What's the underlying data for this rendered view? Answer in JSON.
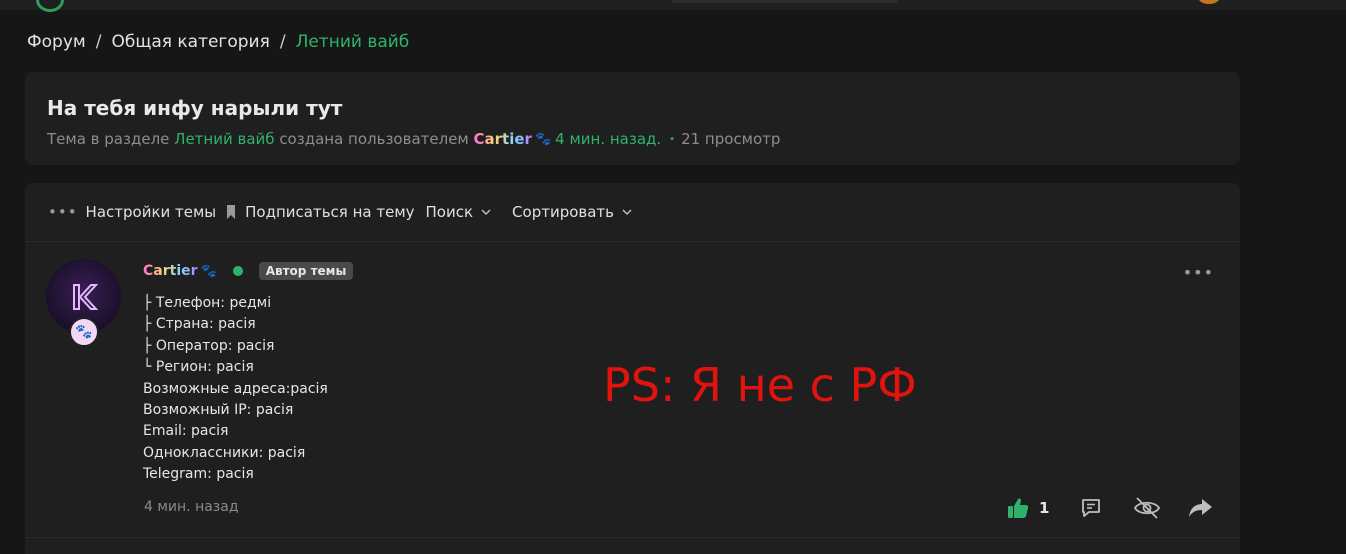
{
  "breadcrumb": {
    "items": [
      "Форум",
      "Общая категория"
    ],
    "separator": "/",
    "current": "Летний вайб"
  },
  "thread": {
    "title": "На тебя инфу нарыли тут",
    "meta_prefix": "Тема в разделе",
    "meta_section": "Летний вайб",
    "meta_created_by": "создана пользователем",
    "author": "Cartier",
    "author_icon": "paw-icon",
    "time_ago": "4 мин. назад.",
    "views": "21 просмотр"
  },
  "toolbar": {
    "settings_label": "Настройки темы",
    "subscribe_label": "Подписаться на тему",
    "search_label": "Поиск",
    "sort_label": "Сортировать"
  },
  "post": {
    "author": "Cartier",
    "online": true,
    "author_badge": "Автор темы",
    "lines": [
      "├ Телефон: редмі",
      "├ Страна: расія",
      "├ Оператор: расія",
      "└ Регион: расія",
      "Возможные адреса:расія",
      "Возможный IP: расія",
      "Email: расія",
      "Одноклассники: расія",
      "Telegram: расія"
    ],
    "overlay_text": "PS: Я не с РФ",
    "time": "4 мин. назад",
    "like_count": "1"
  },
  "colors": {
    "accent": "#2fb36b",
    "overlay_red": "#e0130f",
    "background": "#161616",
    "card": "#1f1f1f"
  }
}
